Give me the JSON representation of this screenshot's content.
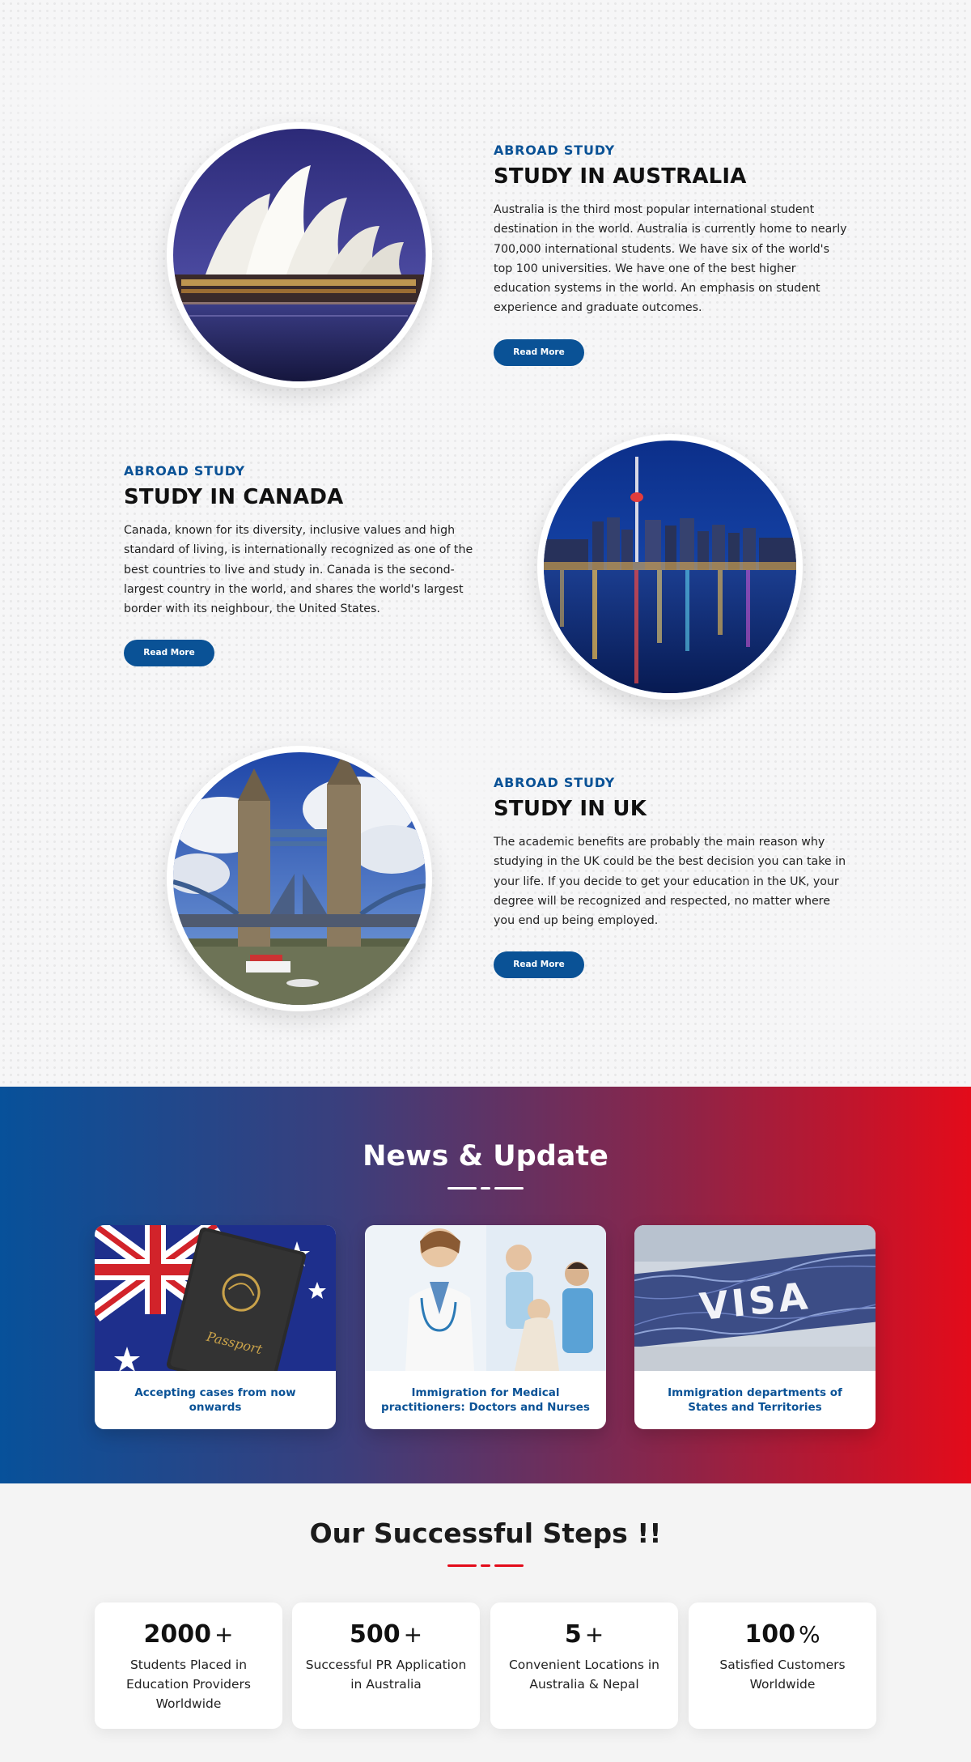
{
  "study": [
    {
      "eyebrow": "ABROAD STUDY",
      "title": "STUDY IN AUSTRALIA",
      "desc": "Australia is the third most popular international student destination in the world. Australia is currently home to nearly 700,000 international students. We have six of the world's top 100 universities. We have one of the best higher education systems in the world. An emphasis on student experience and graduate outcomes.",
      "button": "Read More",
      "image": "sydney-opera-house"
    },
    {
      "eyebrow": "ABROAD STUDY",
      "title": "STUDY IN CANADA",
      "desc": "Canada, known for its diversity, inclusive values and high standard of living, is internationally recognized as one of the best countries to live and study in. Canada is the second-largest country in the world, and shares the world's largest border with its neighbour, the United States.",
      "button": "Read More",
      "image": "toronto-skyline"
    },
    {
      "eyebrow": "ABROAD STUDY",
      "title": "STUDY IN UK",
      "desc": "The academic benefits are probably the main reason why studying in the UK could be the best decision you can take in your life. If you decide to get your education in the UK, your degree will be recognized and respected, no matter where you end up being employed.",
      "button": "Read More",
      "image": "tower-bridge"
    }
  ],
  "news": {
    "title": "News & Update",
    "cards": [
      {
        "caption": "Accepting cases from now onwards",
        "image": "australian-passport"
      },
      {
        "caption": "Immigration for Medical practitioners: Doctors and Nurses",
        "image": "medical-staff"
      },
      {
        "caption": "Immigration departments of States and Territories",
        "image": "visa-stamp",
        "image_text": "VISA"
      }
    ]
  },
  "passport_text": "Passport",
  "steps": {
    "title": "Our Successful Steps !!",
    "items": [
      {
        "number": "2000",
        "suffix": "+",
        "label": "Students Placed in Education Providers Worldwide"
      },
      {
        "number": "500",
        "suffix": "+",
        "label": "Successful PR Application in Australia"
      },
      {
        "number": "5",
        "suffix": "+",
        "label": "Convenient Locations in Australia & Nepal"
      },
      {
        "number": "100",
        "suffix": "%",
        "label": "Satisfied Customers Worldwide"
      }
    ]
  },
  "colors": {
    "primary_blue": "#0a5296",
    "accent_red": "#e30b1a",
    "gradient_start": "#07519a",
    "gradient_end": "#e30b1a"
  }
}
